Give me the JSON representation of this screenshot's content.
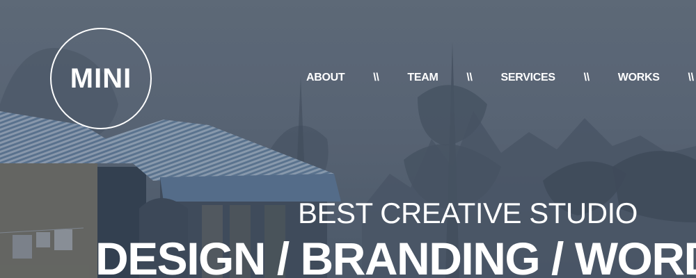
{
  "brand": {
    "logo_text": "MINI"
  },
  "nav": {
    "items": [
      {
        "label": "ABOUT"
      },
      {
        "label": "TEAM"
      },
      {
        "label": "SERVICES"
      },
      {
        "label": "WORKS"
      }
    ],
    "separator": "\\\\"
  },
  "hero": {
    "tagline": "BEST CREATIVE STUDIO",
    "headline": "DESIGN / BRANDING / WORD"
  },
  "colors": {
    "overlay": "#5b6777",
    "text": "#ffffff"
  }
}
